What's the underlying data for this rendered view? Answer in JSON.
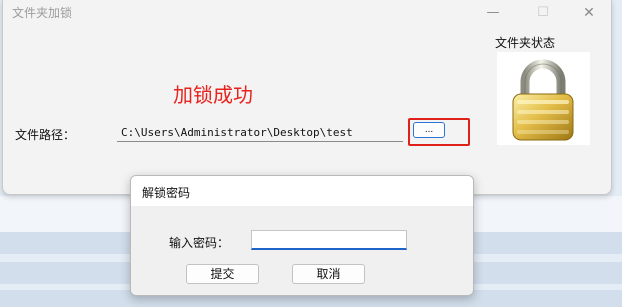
{
  "main_window": {
    "title": "文件夹加锁",
    "controls": {
      "minimize": "—",
      "maximize": "☐",
      "close": "✕"
    },
    "status_label": "文件夹状态",
    "lock_icon": "padlock-icon",
    "success_message": "加锁成功",
    "path_label": "文件路径：",
    "path_value": "C:\\Users\\Administrator\\Desktop\\test",
    "browse_label": "...",
    "colors": {
      "success": "#e8231d",
      "highlight": "#e0201a",
      "accent": "#1e64c8"
    }
  },
  "dialog": {
    "title": "解锁密码",
    "password_label": "输入密码：",
    "password_value": "",
    "submit_label": "提交",
    "cancel_label": "取消"
  }
}
